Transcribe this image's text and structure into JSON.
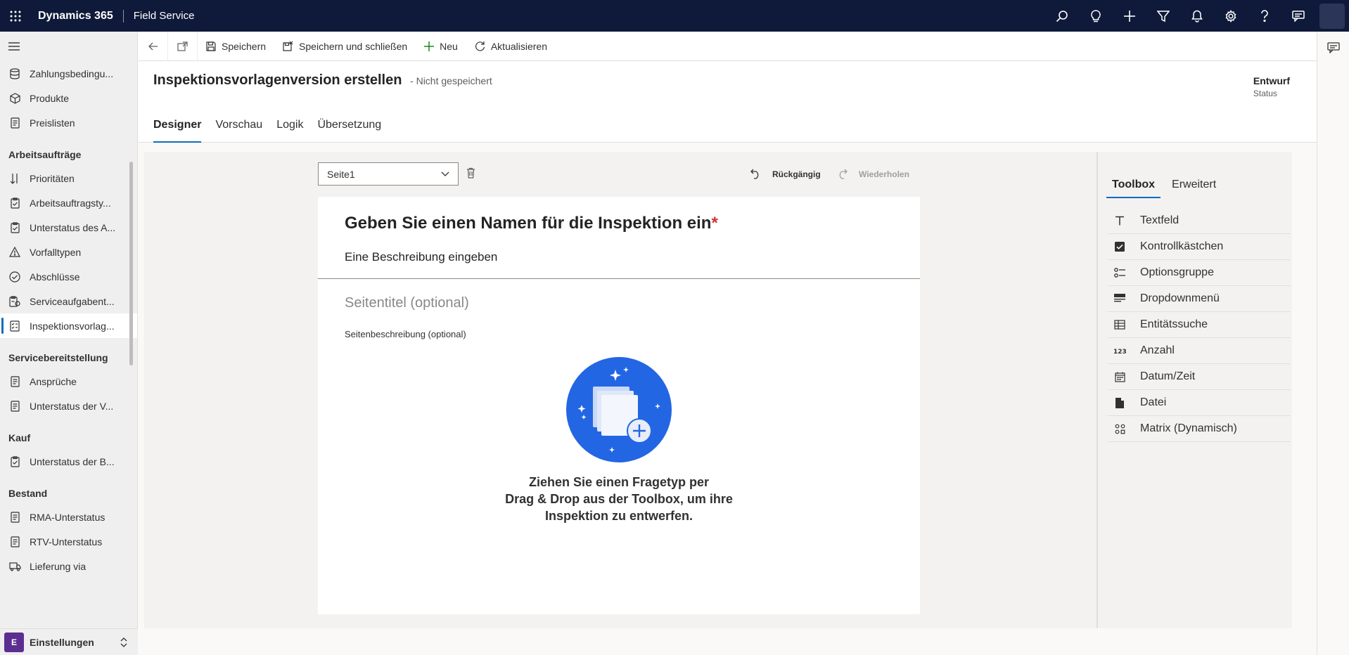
{
  "topbar": {
    "brand": "Dynamics 365",
    "app": "Field Service",
    "icons": [
      "search-icon",
      "lightbulb-icon",
      "plus-icon",
      "filter-icon",
      "bell-icon",
      "gear-icon",
      "help-icon",
      "chat-icon"
    ]
  },
  "nav": {
    "items_top": [
      {
        "label": "Zahlungsbedingu...",
        "icon": "database-icon"
      },
      {
        "label": "Produkte",
        "icon": "box-icon"
      },
      {
        "label": "Preislisten",
        "icon": "document-icon"
      }
    ],
    "groups": [
      {
        "title": "Arbeitsaufträge",
        "items": [
          {
            "label": "Prioritäten",
            "icon": "sort-icon"
          },
          {
            "label": "Arbeitsauftragsty...",
            "icon": "clipboard-icon"
          },
          {
            "label": "Unterstatus des A...",
            "icon": "clipboard-icon"
          },
          {
            "label": "Vorfalltypen",
            "icon": "warning-icon"
          },
          {
            "label": "Abschlüsse",
            "icon": "check-circle-icon"
          },
          {
            "label": "Serviceaufgabent...",
            "icon": "task-icon"
          },
          {
            "label": "Inspektionsvorlag...",
            "icon": "inspection-icon",
            "active": true
          }
        ]
      },
      {
        "title": "Servicebereitstellung",
        "items": [
          {
            "label": "Ansprüche",
            "icon": "document-icon"
          },
          {
            "label": "Unterstatus der V...",
            "icon": "document-icon"
          }
        ]
      },
      {
        "title": "Kauf",
        "items": [
          {
            "label": "Unterstatus der B...",
            "icon": "clipboard-icon"
          }
        ]
      },
      {
        "title": "Bestand",
        "items": [
          {
            "label": "RMA-Unterstatus",
            "icon": "document-icon"
          },
          {
            "label": "RTV-Unterstatus",
            "icon": "document-icon"
          },
          {
            "label": "Lieferung via",
            "icon": "truck-icon"
          }
        ]
      }
    ],
    "area": {
      "badge": "E",
      "label": "Einstellungen"
    }
  },
  "commands": {
    "save": "Speichern",
    "save_close": "Speichern und schließen",
    "new": "Neu",
    "refresh": "Aktualisieren"
  },
  "header": {
    "title": "Inspektionsvorlagenversion erstellen",
    "unsaved": "- Nicht gespeichert",
    "status_value": "Entwurf",
    "status_label": "Status",
    "tabs": [
      "Designer",
      "Vorschau",
      "Logik",
      "Übersetzung"
    ]
  },
  "designer": {
    "page_select": "Seite1",
    "undo": "Rückgängig",
    "redo": "Wiederholen",
    "inspection_name": "Geben Sie einen Namen für die Inspektion ein",
    "required_mark": "*",
    "inspection_description": "Eine Beschreibung eingeben",
    "page_title_placeholder": "Seitentitel (optional)",
    "page_desc_placeholder": "Seitenbeschreibung (optional)",
    "empty_message": "Ziehen Sie einen Fragetyp per\nDrag & Drop aus der Toolbox, um ihre\nInspektion zu entwerfen."
  },
  "toolbox": {
    "tabs": [
      "Toolbox",
      "Erweitert"
    ],
    "items": [
      {
        "label": "Textfeld",
        "icon": "text-icon"
      },
      {
        "label": "Kontrollkästchen",
        "icon": "checkbox-icon"
      },
      {
        "label": "Optionsgruppe",
        "icon": "radio-list-icon"
      },
      {
        "label": "Dropdownmenü",
        "icon": "dropdown-icon"
      },
      {
        "label": "Entitätssuche",
        "icon": "table-icon"
      },
      {
        "label": "Anzahl",
        "icon": "number-icon"
      },
      {
        "label": "Datum/Zeit",
        "icon": "calendar-icon"
      },
      {
        "label": "Datei",
        "icon": "file-icon"
      },
      {
        "label": "Matrix (Dynamisch)",
        "icon": "matrix-icon"
      }
    ]
  },
  "colors": {
    "topbar": "#0f1a3a",
    "accent": "#0f6cbd",
    "area_badge": "#5c2e91",
    "required": "#d13438"
  }
}
